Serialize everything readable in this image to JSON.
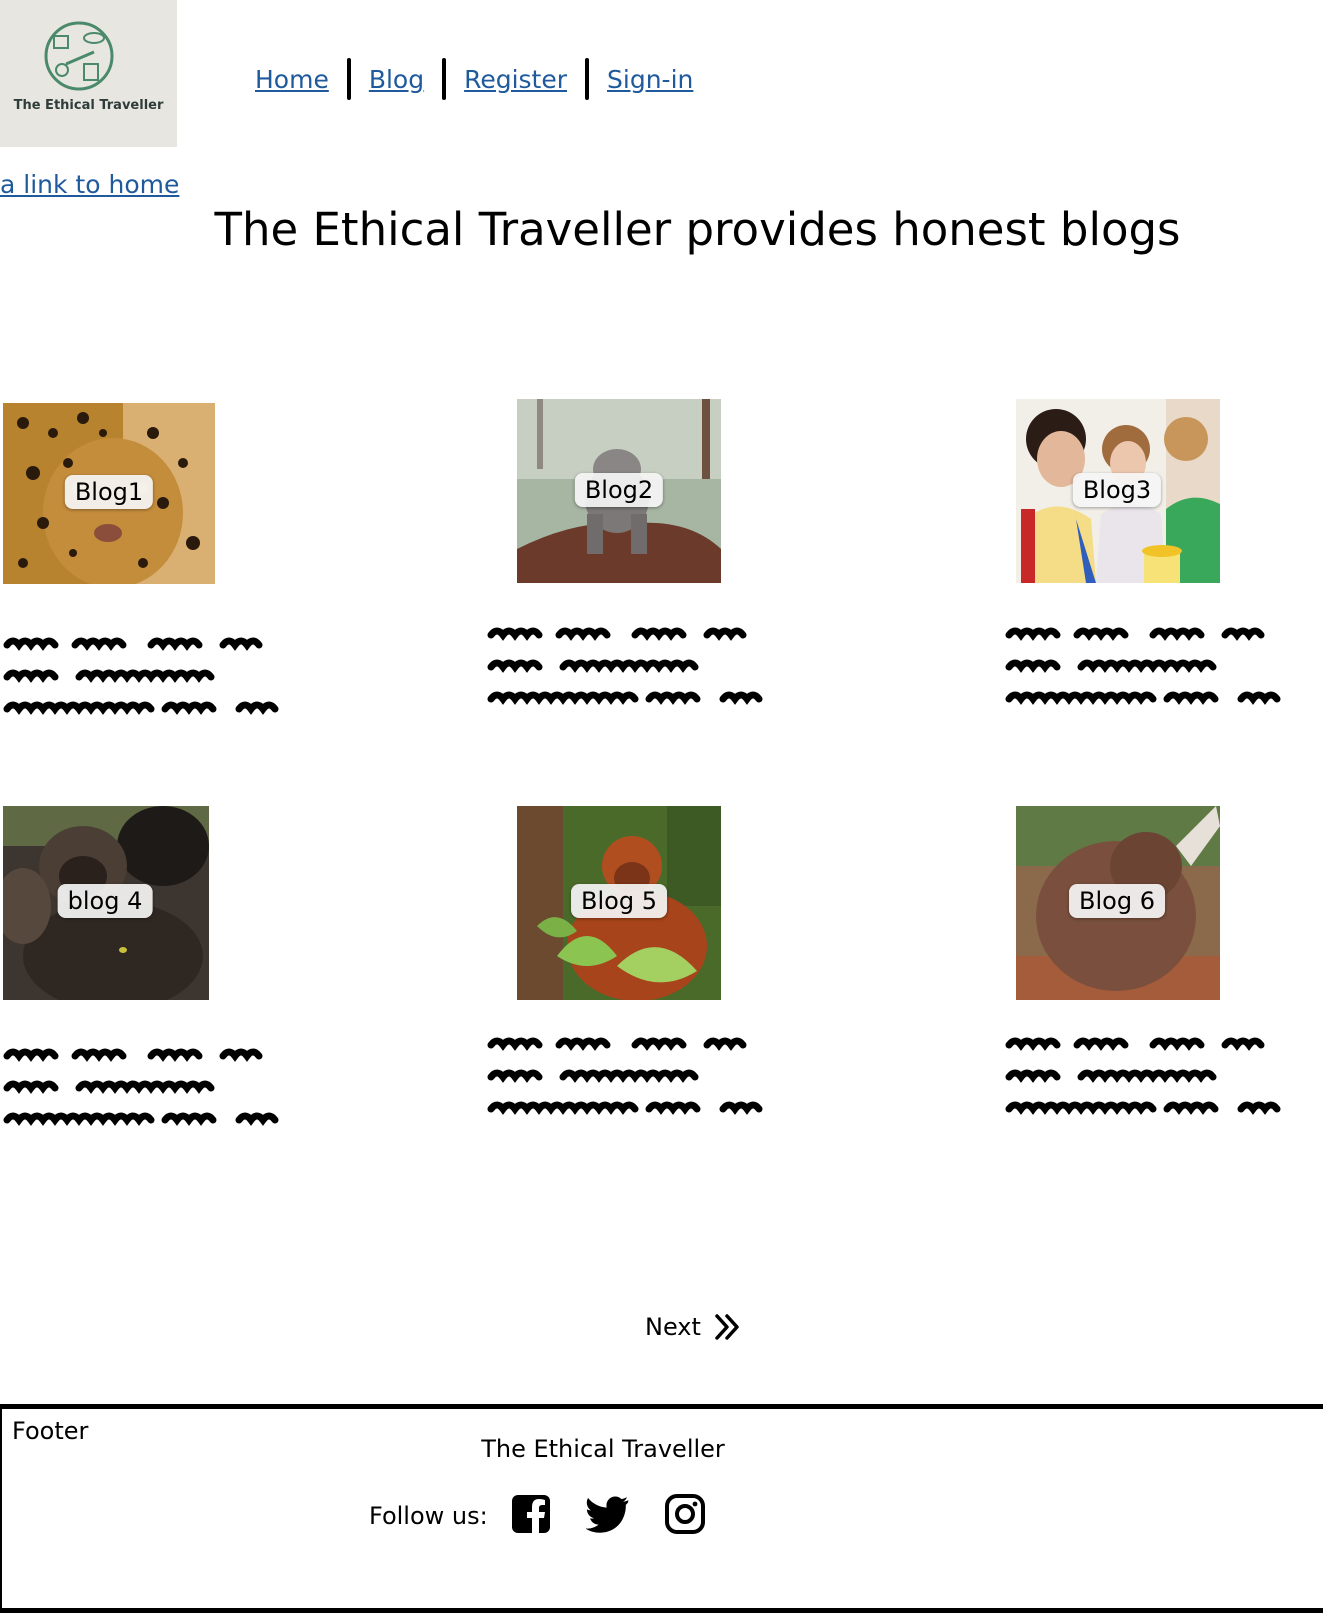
{
  "brand": {
    "logo_text": "The Ethical Traveller",
    "accent": "#1f5a9c",
    "logo_green": "#4a8a6a"
  },
  "nav": {
    "items": [
      "Home",
      "Blog",
      "Register",
      "Sign-in"
    ]
  },
  "home_link": "a link to home",
  "headline": "The Ethical Traveller provides honest blogs",
  "blogs": [
    {
      "label": "Blog1",
      "image": "jaguar"
    },
    {
      "label": "Blog2",
      "image": "baby-elephant"
    },
    {
      "label": "Blog3",
      "image": "children-painting"
    },
    {
      "label": "blog 4",
      "image": "gorillas"
    },
    {
      "label": "Blog 5",
      "image": "orangutan"
    },
    {
      "label": "Blog 6",
      "image": "blurred-animal"
    }
  ],
  "pagination": {
    "next_label": "Next",
    "icon": "double-chevron-right-icon"
  },
  "footer": {
    "label": "Footer",
    "title": "The Ethical Traveller",
    "follow_label": "Follow us:",
    "social": [
      "facebook-icon",
      "twitter-icon",
      "instagram-icon"
    ]
  }
}
